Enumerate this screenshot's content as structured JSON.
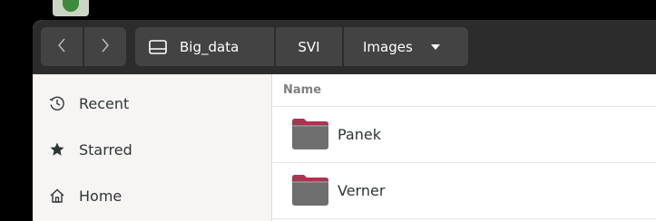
{
  "window": {
    "path": {
      "drive_icon": "drive-icon",
      "segments": [
        "Big_data",
        "SVI",
        "Images"
      ]
    },
    "nav": {
      "back_icon": "chevron-left-icon",
      "forward_icon": "chevron-right-icon"
    }
  },
  "sidebar": {
    "items": [
      {
        "label": "Recent",
        "icon": "clock-icon"
      },
      {
        "label": "Starred",
        "icon": "star-icon"
      },
      {
        "label": "Home",
        "icon": "home-icon"
      }
    ]
  },
  "file_list": {
    "column_header": "Name",
    "items": [
      {
        "name": "Panek",
        "icon": "folder-icon"
      },
      {
        "name": "Verner",
        "icon": "folder-icon"
      }
    ]
  },
  "colors": {
    "headerbar": "#2c2c2c",
    "button": "#434343",
    "sidebar": "#f6f5f4",
    "folder_tab": "#a73553",
    "folder_body": "#6e6e6e"
  }
}
